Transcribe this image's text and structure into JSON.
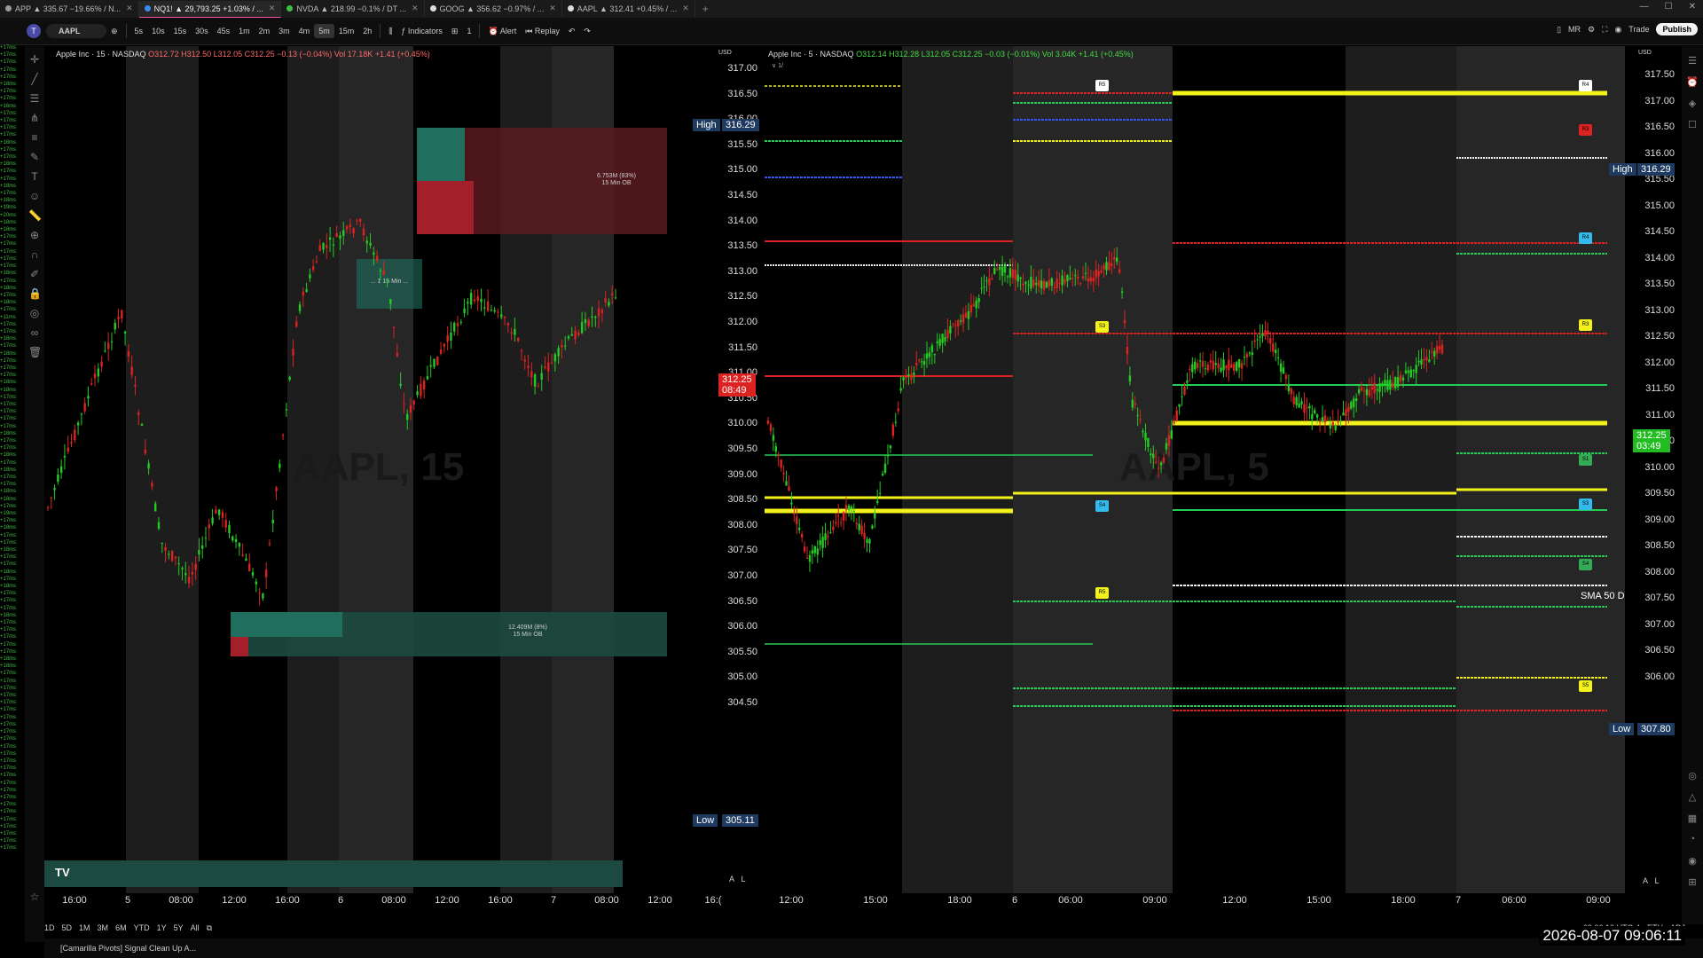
{
  "tabs": [
    {
      "label": "APP ▲ 335.67 −19.66% / N...",
      "color": "#9a9a9a",
      "active": false
    },
    {
      "label": "NQ1! ▲ 29,793.25 +1.03% / ...",
      "color": "#3a8ee6",
      "active": true
    },
    {
      "label": "NVDA ▲ 218.99 −0.1% / DT ...",
      "color": "#3fbf3f",
      "active": false
    },
    {
      "label": "GOOG ▲ 356.62 −0.97% / ...",
      "color": "#dddddd",
      "active": false
    },
    {
      "label": "AAPL ▲ 312.41 +0.45% / ...",
      "color": "#dddddd",
      "active": false
    }
  ],
  "window_buttons": [
    "—",
    "☐",
    "✕"
  ],
  "toolbar": {
    "symbol": "AAPL",
    "timeframes": [
      "5s",
      "10s",
      "15s",
      "30s",
      "45s",
      "1m",
      "2m",
      "3m",
      "4m",
      "5m",
      "15m",
      "2h"
    ],
    "selected_timeframe": "5m",
    "indicators_label": "Indicators",
    "alert_label": "Alert",
    "replay_label": "Replay",
    "count": "1",
    "right_items": [
      "MR",
      "Trade"
    ],
    "publish_label": "Publish",
    "avatar": "T"
  },
  "left_chart": {
    "title": "Apple Inc · 15 · NASDAQ",
    "ohlc": "O312.72 H312.50 L312.05 C312.25 −0.13 (−0.04%) Vol 17.18K +1.41 (+0.45%)",
    "watermark": "AAPL, 15",
    "y_ticks": [
      "317.00",
      "316.50",
      "316.00",
      "315.50",
      "315.00",
      "314.50",
      "314.00",
      "313.50",
      "313.00",
      "312.50",
      "312.00",
      "311.50",
      "311.00",
      "310.50",
      "310.00",
      "309.50",
      "309.00",
      "308.50",
      "308.00",
      "307.50",
      "307.00",
      "306.50",
      "306.00",
      "305.50",
      "305.00",
      "304.50"
    ],
    "high_label": "High",
    "high_value": "316.29",
    "low_label": "Low",
    "low_value": "305.11",
    "price_label": "312.25",
    "countdown": "08:49",
    "x_ticks": [
      "16:00",
      "5",
      "08:00",
      "12:00",
      "16:00",
      "6",
      "08:00",
      "12:00",
      "16:00",
      "7",
      "08:00",
      "12:00",
      "16:("
    ],
    "zone_top_label": "6.753M (83%)\n15 Min OB",
    "zone_bottom_label": "12.409M (8%)\n15 Min OB",
    "zone_mid_label": "... 1 15 Min ...",
    "currency": "USD",
    "scale_btns": [
      "A",
      "L"
    ]
  },
  "right_chart": {
    "title": "Apple Inc · 5 · NASDAQ",
    "ohlc": "O312.14 H312.28 L312.05 C312.25 −0.03 (−0.01%) Vol 3.04K +1.41 (+0.45%)",
    "watermark": "AAPL, 5",
    "y_ticks": [
      "317.50",
      "317.00",
      "316.50",
      "316.00",
      "315.50",
      "315.00",
      "314.50",
      "314.00",
      "313.50",
      "313.00",
      "312.50",
      "312.00",
      "311.50",
      "311.00",
      "310.50",
      "310.00",
      "309.50",
      "309.00",
      "308.50",
      "308.00",
      "307.50",
      "307.00",
      "306.50",
      "306.00"
    ],
    "high_label": "High",
    "high_value": "316.29",
    "low_label": "Low",
    "low_value": "307.80",
    "price_label": "312.25",
    "countdown": "03:49",
    "sma_label": "SMA 50 D",
    "x_ticks": [
      "12:00",
      "15:00",
      "18:00",
      "6",
      "06:00",
      "09:00",
      "12:00",
      "15:00",
      "18:00",
      "7",
      "06:00",
      "09:00"
    ],
    "badges": [
      "R5",
      "R4",
      "R3",
      "S3",
      "S4",
      "R5",
      "R4",
      "R3",
      "S1",
      "S3",
      "S4",
      "S5"
    ],
    "currency": "USD",
    "scale_btns": [
      "A",
      "L"
    ],
    "subtitle": "∨ 1/",
    "timezone": "09:06:10 UTC-4",
    "session": "ETH",
    "adj": "ADJ"
  },
  "bottom_ranges": [
    "1D",
    "5D",
    "1M",
    "3M",
    "6M",
    "YTD",
    "1Y",
    "5Y",
    "All"
  ],
  "status_text": "[Camarilla Pivots] Signal Clean Up A...",
  "clock": "2026-08-07  09:06:11",
  "watchlist_values": [
    "+17ms",
    "+17ms",
    "+17ms",
    "+17ms",
    "+17ms",
    "+18ms",
    "+17ms",
    "+17ms",
    "+16ms",
    "+17ms",
    "+17ms",
    "+17ms",
    "+17ms",
    "+18ms",
    "+17ms",
    "+17ms",
    "+18ms",
    "+17ms",
    "+17ms",
    "+18ms",
    "+17ms",
    "+18ms",
    "+19ms",
    "+20ms",
    "+18ms",
    "+18ms",
    "+17ms",
    "+17ms",
    "+17ms",
    "+17ms",
    "+17ms",
    "+18ms",
    "+17ms",
    "+18ms",
    "+17ms",
    "+18ms",
    "+17ms",
    "+11ms",
    "+17ms",
    "+17ms",
    "+18ms",
    "+17ms",
    "+18ms",
    "+17ms",
    "+17ms",
    "+17ms",
    "+18ms",
    "+18ms",
    "+17ms",
    "+17ms",
    "+17ms",
    "+17ms",
    "+17ms",
    "+18ms",
    "+17ms",
    "+17ms",
    "+18ms",
    "+17ms",
    "+18ms",
    "+17ms",
    "+17ms",
    "+18ms",
    "+18ms",
    "+17ms",
    "+19ms",
    "+17ms",
    "+18ms",
    "+17ms",
    "+17ms",
    "+18ms",
    "+17ms",
    "+17ms",
    "+18ms",
    "+17ms",
    "+18ms",
    "+17ms",
    "+17ms",
    "+17ms",
    "+18ms",
    "+17ms",
    "+17ms",
    "+17ms",
    "+17ms",
    "+17ms",
    "+18ms",
    "+18ms",
    "+17ms",
    "+17ms",
    "+17ms",
    "+17ms",
    "+17ms",
    "+17ms",
    "+17ms",
    "+17ms",
    "+17ms",
    "+17ms",
    "+17ms",
    "+17ms",
    "+17ms",
    "+17ms",
    "+17ms",
    "+17ms",
    "+17ms",
    "+17ms",
    "+17ms",
    "+17ms",
    "+17ms",
    "+17ms",
    "+17ms",
    "+17ms",
    "+17ms"
  ],
  "colors": {
    "up": "#22cc22",
    "down": "#dd2222",
    "yellow": "#f2f21a",
    "green_line": "#22cc55",
    "red_line": "#dd2222",
    "blue_line": "#3355ee",
    "white_line": "#eeeeee",
    "teal_zone": "#1f6e5e",
    "red_zone": "#7a1e24"
  }
}
